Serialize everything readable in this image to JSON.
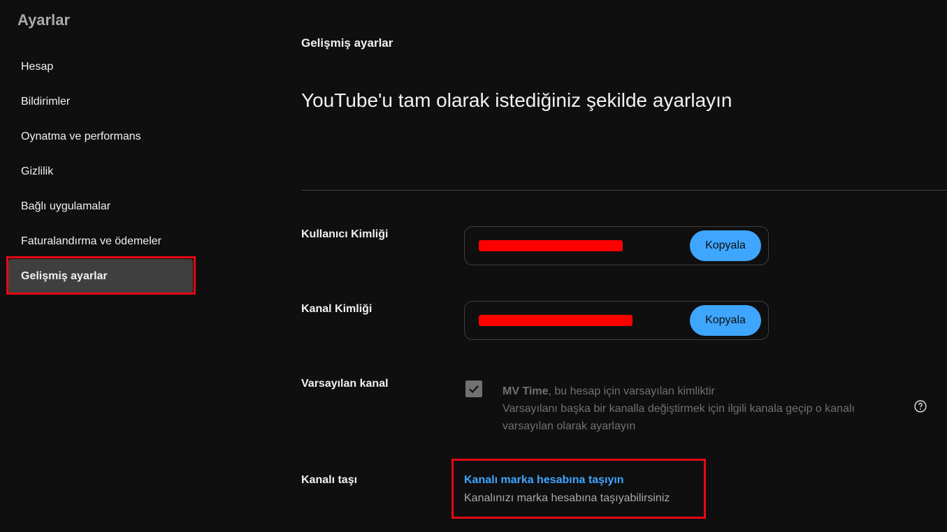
{
  "sidebar": {
    "title": "Ayarlar",
    "items": [
      {
        "label": "Hesap",
        "active": false
      },
      {
        "label": "Bildirimler",
        "active": false
      },
      {
        "label": "Oynatma ve performans",
        "active": false
      },
      {
        "label": "Gizlilik",
        "active": false
      },
      {
        "label": "Bağlı uygulamalar",
        "active": false
      },
      {
        "label": "Faturalandırma ve ödemeler",
        "active": false
      },
      {
        "label": "Gelişmiş ayarlar",
        "active": true
      }
    ]
  },
  "main": {
    "section_title": "Gelişmiş ayarlar",
    "headline": "YouTube'u tam olarak istediğiniz şekilde ayarlayın",
    "user_id": {
      "label": "Kullanıcı Kimliği",
      "value": "xxxxxxxypxxxy_",
      "copy_label": "Kopyala"
    },
    "channel_id": {
      "label": "Kanal Kimliği",
      "value": "xxxxxxxypxxxy_xxxxxxxxx",
      "copy_label": "Kopyala"
    },
    "default_channel": {
      "label": "Varsayılan kanal",
      "checked": true,
      "channel_name": "MV Time",
      "line1_rest": ", bu hesap için varsayılan kimliktir",
      "line2": "Varsayılanı başka bir kanalla değiştirmek için ilgili kanala geçip o kanalı varsayılan olarak ayarlayın"
    },
    "move_channel": {
      "label": "Kanalı taşı",
      "link": "Kanalı marka hesabına taşıyın",
      "description": "Kanalınızı marka hesabına taşıyabilirsiniz"
    }
  },
  "colors": {
    "background": "#0f0f0f",
    "accent_blue": "#3ea6ff",
    "highlight_red": "#e50914",
    "active_item_bg": "#3f3f3f"
  },
  "icons": [
    "checkmark-icon",
    "help-icon"
  ]
}
